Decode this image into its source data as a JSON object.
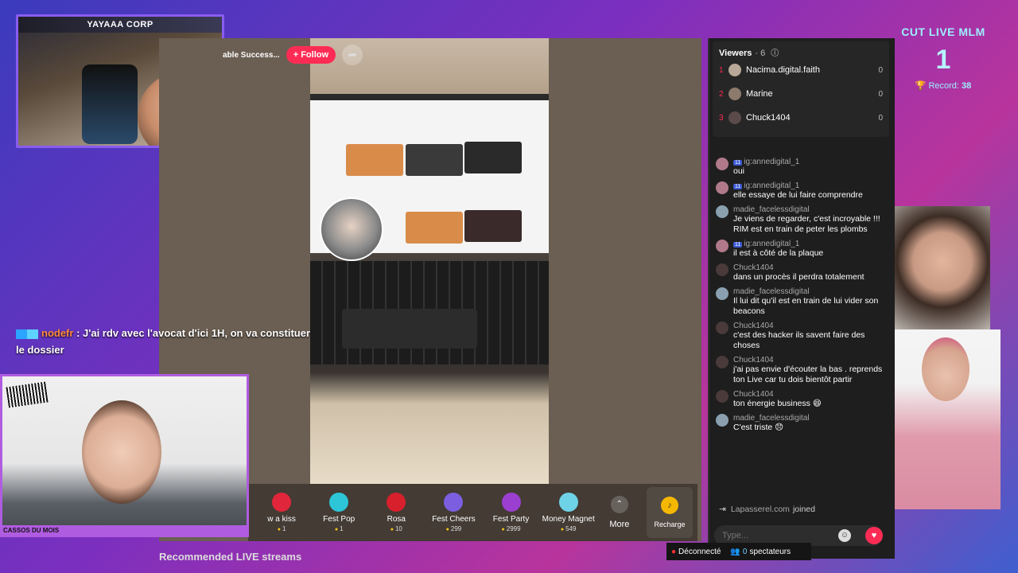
{
  "overlay": {
    "top_cam_banner": "YAYAAA CORP",
    "counter_title": "CUT LIVE MLM",
    "counter_value": "1",
    "record_label": "Record:",
    "record_value": "38",
    "bottom_cam_label": "CASSOS DU MOIS",
    "chat_line": {
      "user": "nodefr",
      "text": ": J'ai rdv avec l'avocat d'ici 1H, on va constituer le dossier"
    }
  },
  "stream": {
    "title_fragment": "able Success...",
    "follow_label": "+ Follow",
    "share_icon": "share-arrow-icon"
  },
  "gifts": [
    {
      "name": "w a kiss",
      "price": "1",
      "icon": "kiss-lips-icon",
      "color": "#e0263a"
    },
    {
      "name": "Fest Pop",
      "price": "1",
      "icon": "fest-pop-icon",
      "color": "#2dc6d8"
    },
    {
      "name": "Rosa",
      "price": "10",
      "icon": "rose-icon",
      "color": "#d81f2c"
    },
    {
      "name": "Fest Cheers",
      "price": "299",
      "icon": "fest-cheers-icon",
      "color": "#7b5fe0"
    },
    {
      "name": "Fest Party",
      "price": "2999",
      "icon": "fest-party-icon",
      "color": "#9b3fd0"
    },
    {
      "name": "Money Magnet",
      "price": "549",
      "icon": "money-magnet-icon",
      "color": "#6fd3e8"
    }
  ],
  "gift_controls": {
    "more_label": "More",
    "recharge_label": "Recharge"
  },
  "viewers": {
    "title": "Viewers",
    "count": "· 6",
    "list": [
      {
        "rank": "1",
        "name": "Nacima.digital.faith",
        "score": "0"
      },
      {
        "rank": "2",
        "name": "Marine",
        "score": "0"
      },
      {
        "rank": "3",
        "name": "Chuck1404",
        "score": "0"
      }
    ]
  },
  "chat": [
    {
      "user": "ig:annedigital_1",
      "badge": "11",
      "text": "oui"
    },
    {
      "user": "ig:annedigital_1",
      "badge": "11",
      "text": "elle essaye de lui faire comprendre"
    },
    {
      "user": "madie_facelessdigital",
      "badge": "",
      "text": "Je viens de regarder, c'est incroyable !!! RIM est en train de peter les plombs"
    },
    {
      "user": "ig:annedigital_1",
      "badge": "11",
      "text": "il est à côté de la plaque"
    },
    {
      "user": "Chuck1404",
      "badge": "",
      "text": "dans un procès il perdra totalement"
    },
    {
      "user": "madie_facelessdigital",
      "badge": "",
      "text": "Il lui dit qu'il est en train de lui vider son beacons"
    },
    {
      "user": "Chuck1404",
      "badge": "",
      "text": "c'est des hacker ils savent faire des choses"
    },
    {
      "user": "Chuck1404",
      "badge": "",
      "text": "j'ai pas envie d'écouter la bas . reprends ton Live car tu dois bientôt partir"
    },
    {
      "user": "Chuck1404",
      "badge": "",
      "text": "ton énergie business 😄"
    },
    {
      "user": "madie_facelessdigital",
      "badge": "",
      "text": "C'est triste 😞"
    }
  ],
  "joined": {
    "name": "Lapasserel.com",
    "text": "joined"
  },
  "input": {
    "placeholder": "Type..."
  },
  "recommended_label": "Recommended LIVE streams",
  "status": {
    "disconnected": "Déconnecté",
    "spectators_count": "0",
    "spectators_label": "spectateurs"
  }
}
